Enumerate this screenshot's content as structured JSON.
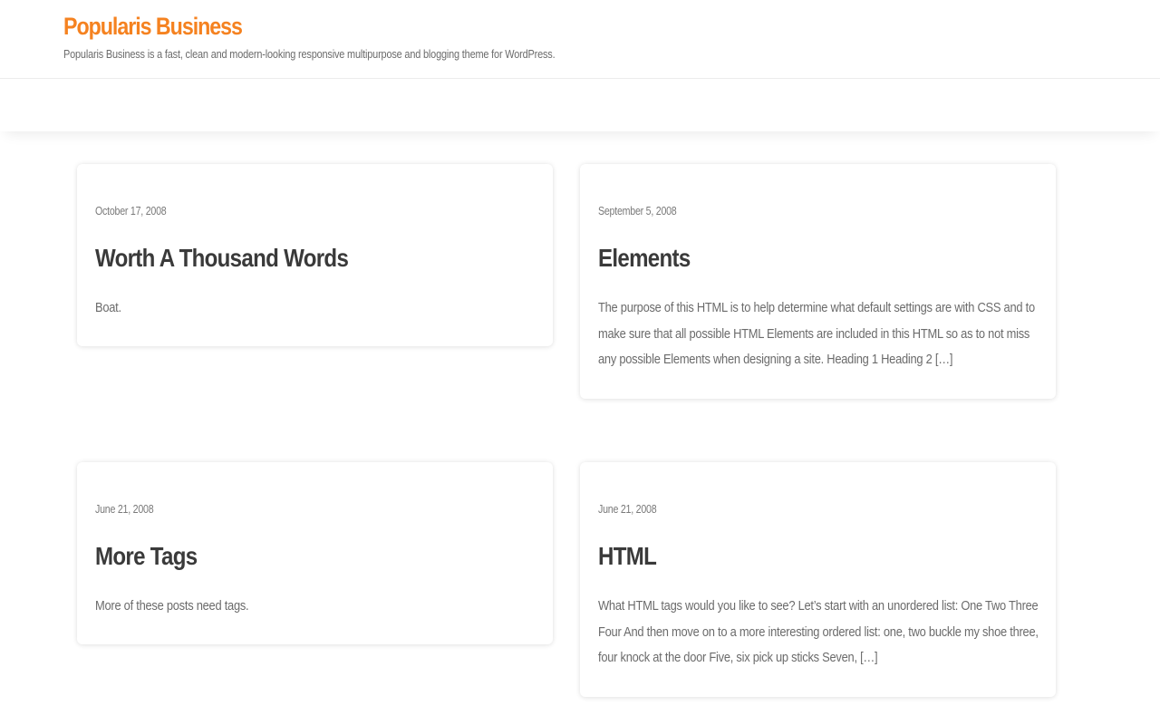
{
  "site": {
    "title": "Popularis Business",
    "description": "Popularis Business is a fast, clean and modern-looking responsive multipurpose and blogging theme for WordPress.",
    "accent_color": "#f58220"
  },
  "posts": [
    {
      "date": "October 17, 2008",
      "title": "Worth A Thousand Words",
      "excerpt": "Boat."
    },
    {
      "date": "September 5, 2008",
      "title": "Elements",
      "excerpt": "The purpose of this HTML is to help determine what default settings are with CSS and to make sure that all possible HTML Elements are included in this HTML so as to not miss any possible Elements when designing a site. Heading 1 Heading 2 […]"
    },
    {
      "date": "June 21, 2008",
      "title": "More Tags",
      "excerpt": "More of these posts need tags."
    },
    {
      "date": "June 21, 2008",
      "title": "HTML",
      "excerpt": "What HTML tags would you like to see? Let’s start with an unordered list: One Two Three Four And then move on to a more interesting ordered list: one, two buckle my shoe three, four knock at the door Five, six pick up sticks Seven, […]"
    }
  ]
}
